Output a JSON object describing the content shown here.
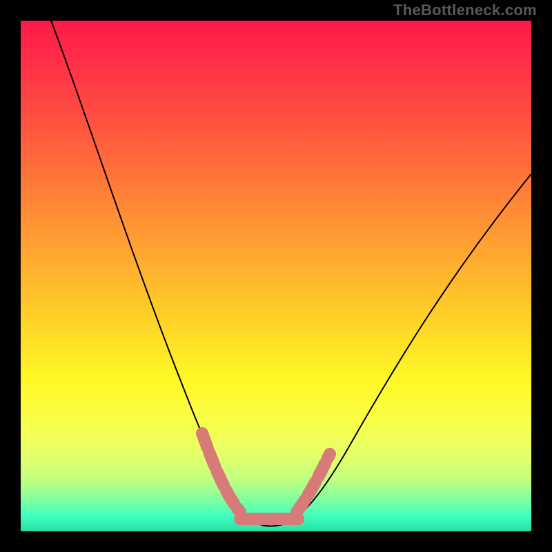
{
  "watermark": "TheBottleneck.com",
  "colors": {
    "background": "#000000",
    "gradient_top": "#ff1a47",
    "gradient_mid": "#fff824",
    "gradient_bottom": "#26e0a3",
    "curve": "#000000",
    "marker": "#d87a78"
  },
  "chart_data": {
    "type": "line",
    "title": "",
    "xlabel": "",
    "ylabel": "",
    "xlim": [
      0,
      100
    ],
    "ylim": [
      0,
      100
    ],
    "series": [
      {
        "name": "bottleneck-curve",
        "x": [
          6,
          10,
          15,
          20,
          25,
          30,
          34,
          37,
          40,
          42,
          44,
          47,
          50,
          54,
          58,
          63,
          70,
          78,
          86,
          94,
          100
        ],
        "y": [
          100,
          86,
          71,
          57,
          44,
          32,
          23,
          15,
          9,
          5,
          2,
          1,
          1,
          2,
          6,
          13,
          23,
          35,
          47,
          59,
          67
        ]
      }
    ],
    "marker_region": {
      "name": "optimal-range",
      "x": [
        37,
        40,
        42,
        44,
        47,
        50,
        54,
        58
      ],
      "y": [
        15,
        9,
        5,
        2,
        1,
        1,
        2,
        6
      ]
    }
  }
}
